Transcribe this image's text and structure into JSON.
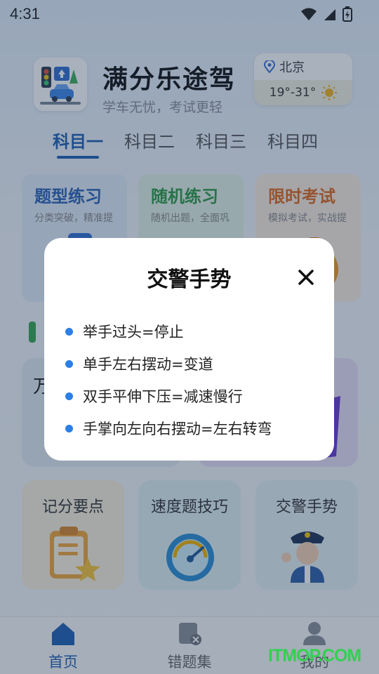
{
  "status": {
    "time": "4:31"
  },
  "header": {
    "title": "满分乐途驾",
    "slogan": "学车无忧，考试更轻",
    "weather": {
      "city": "北京",
      "temperature": "19°-31°"
    }
  },
  "tabs": [
    {
      "label": "科目一",
      "active": true
    },
    {
      "label": "科目二",
      "active": false
    },
    {
      "label": "科目三",
      "active": false
    },
    {
      "label": "科目四",
      "active": false
    }
  ],
  "practice_cards": [
    {
      "title": "题型练习",
      "subtitle": "分类突破，精准提",
      "color": "#2a63b8",
      "bg": "#e3ecf8"
    },
    {
      "title": "随机练习",
      "subtitle": "随机出题，全面巩",
      "color": "#2f9a46",
      "bg": "#e4f3e7"
    },
    {
      "title": "限时考试",
      "subtitle": "模拟考试，实战提",
      "color": "#e06a1e",
      "bg": "#fbeee0"
    }
  ],
  "big_card": {
    "text": "万"
  },
  "tools": [
    {
      "label": "记分要点",
      "bg": "#f8f0dc"
    },
    {
      "label": "速度题技巧",
      "bg": "#e2f1f4"
    },
    {
      "label": "交警手势",
      "bg": "#e6f0f4"
    }
  ],
  "nav": [
    {
      "label": "首页",
      "active": true
    },
    {
      "label": "错题集",
      "active": false
    },
    {
      "label": "我的",
      "active": false
    }
  ],
  "watermark": "ITMOP.COM",
  "modal": {
    "title": "交警手势",
    "items": [
      "举手过头=停止",
      "单手左右摆动=变道",
      "双手平伸下压=减速慢行",
      "手掌向左向右摆动=左右转弯"
    ]
  },
  "colors": {
    "accent": "#1f5fb3",
    "bullet": "#2b7fe6",
    "watermark": "#33d050"
  }
}
